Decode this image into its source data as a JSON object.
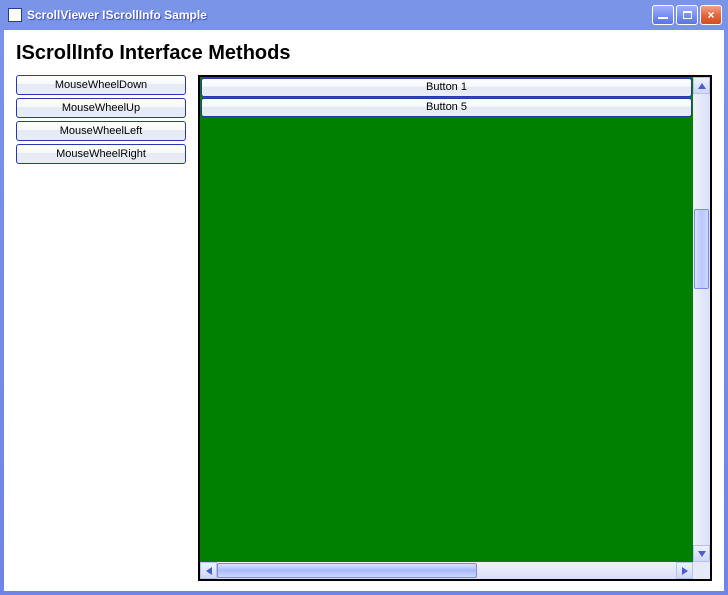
{
  "window": {
    "title": "ScrollViewer IScrollInfo Sample"
  },
  "heading": "IScrollInfo Interface Methods",
  "sideButtons": [
    {
      "label": "MouseWheelDown"
    },
    {
      "label": "MouseWheelUp"
    },
    {
      "label": "MouseWheelLeft"
    },
    {
      "label": "MouseWheelRight"
    }
  ],
  "contentButtons": [
    {
      "label": "Button 1"
    },
    {
      "label": "Button 5"
    }
  ],
  "colors": {
    "viewportBackground": "#008000",
    "windowChrome": "#6f84e6"
  }
}
